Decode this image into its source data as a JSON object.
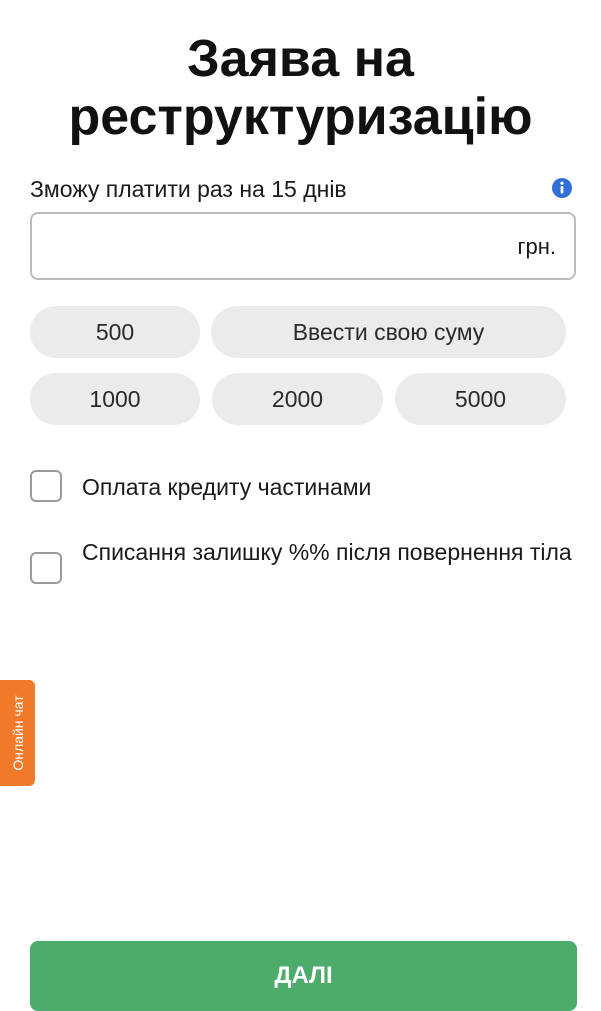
{
  "page": {
    "title": "Заява на реструктуризацію"
  },
  "amount": {
    "label": "Зможу платити раз на 15 днів",
    "info_icon": "info-icon",
    "value": "",
    "placeholder": "",
    "currency": "грн."
  },
  "presets": {
    "chips": [
      "500",
      "Ввести свою суму",
      "1000",
      "2000",
      "5000"
    ]
  },
  "options": [
    {
      "label": "Оплата кредиту частинами",
      "checked": false
    },
    {
      "label": "Списання залишку %% після повернення тіла",
      "checked": false
    }
  ],
  "chat": {
    "label": "Онлайн чат"
  },
  "footer": {
    "next_label": "ДАЛІ"
  },
  "colors": {
    "accent_green": "#4dab6b",
    "chat_orange": "#f07a2a",
    "info_blue": "#2f6fd6",
    "chip_bg": "#ebebeb"
  }
}
